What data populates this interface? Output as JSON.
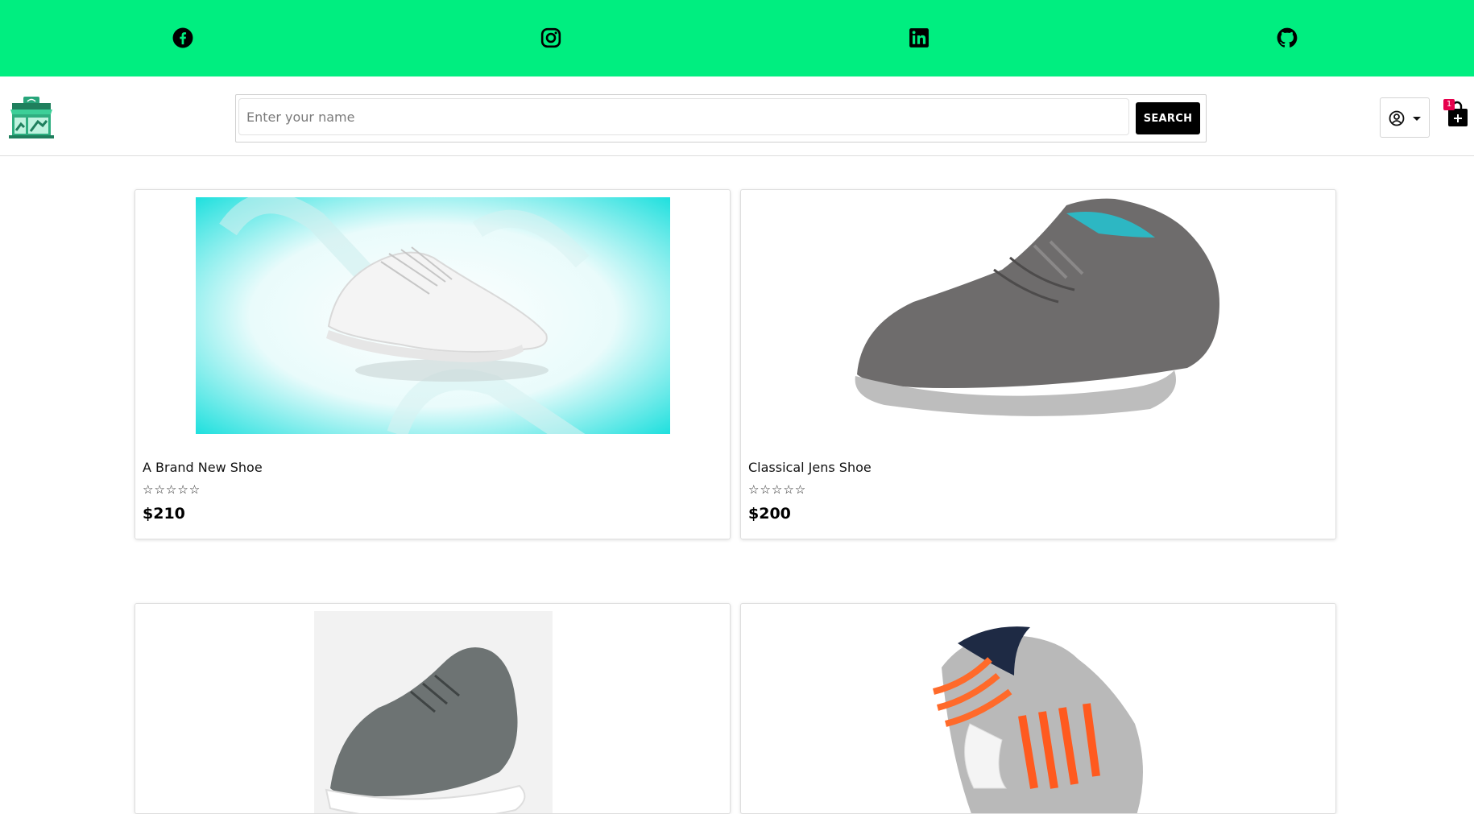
{
  "social": {
    "links": [
      {
        "name": "Facebook",
        "icon": "facebook-icon"
      },
      {
        "name": "Instagram",
        "icon": "instagram-icon"
      },
      {
        "name": "LinkedIn",
        "icon": "linkedin-icon"
      },
      {
        "name": "GitHub",
        "icon": "github-icon"
      }
    ],
    "bar_color": "#00ee80"
  },
  "header": {
    "logo_icon": "store-icon",
    "search": {
      "placeholder": "Enter your name",
      "value": "",
      "button_label": "SEARCH"
    },
    "user_menu": {
      "icon": "user-circle-icon"
    },
    "cart": {
      "icon": "shopping-bag-icon",
      "count": "1"
    }
  },
  "products": [
    {
      "title": "A Brand New Shoe",
      "rating": "☆☆☆☆☆",
      "price": "$210"
    },
    {
      "title": "Classical Jens Shoe",
      "rating": "☆☆☆☆☆",
      "price": "$200"
    },
    {
      "title": "",
      "rating": "",
      "price": ""
    },
    {
      "title": "",
      "rating": "",
      "price": ""
    }
  ],
  "colors": {
    "accent": "#00ee80",
    "button": "#000000",
    "badge": "#e6004c"
  }
}
